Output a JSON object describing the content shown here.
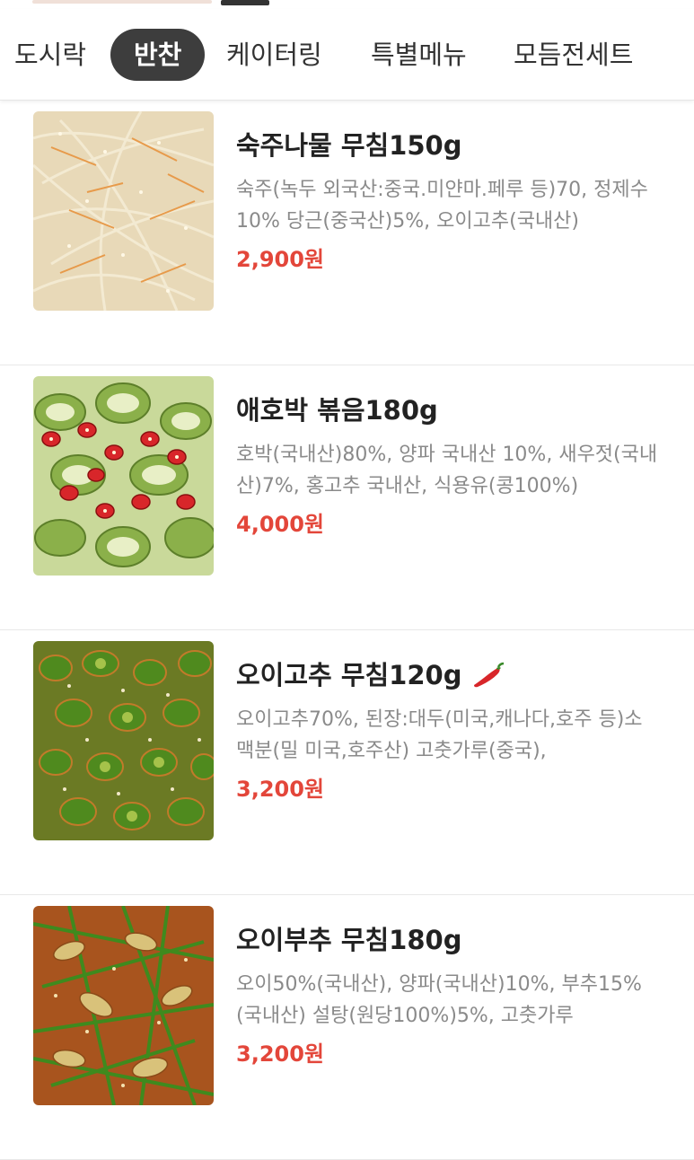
{
  "tabs": [
    {
      "label": "도시락",
      "active": false
    },
    {
      "label": "반찬",
      "active": true
    },
    {
      "label": "케이터링",
      "active": false
    },
    {
      "label": "특별메뉴",
      "active": false
    },
    {
      "label": "모듬전세트",
      "active": false
    }
  ],
  "items": [
    {
      "name": "숙주나물 무침150g",
      "description": "숙주(녹두 외국산:중국.미얀마.페루 등)70, 정제수10% 당근(중국산)5%, 오이고추(국내산)",
      "price": "2,900원",
      "spicy": false,
      "image": "bean-sprout-salad-photo"
    },
    {
      "name": "애호박 볶음180g",
      "description": "호박(국내산)80%, 양파 국내산 10%, 새우젓(국내산)7%, 홍고추 국내산, 식용유(콩100%)",
      "price": "4,000원",
      "spicy": false,
      "image": "zucchini-stir-fry-photo"
    },
    {
      "name": "오이고추 무침120g",
      "description": "오이고추70%, 된장:대두(미국,캐나다,호주 등)소맥분(밀 미국,호주산) 고춧가루(중국),",
      "price": "3,200원",
      "spicy": true,
      "image": "seasoned-pepper-photo"
    },
    {
      "name": "오이부추 무침180g",
      "description": "오이50%(국내산), 양파(국내산)10%, 부추15%(국내산) 설탕(원당100%)5%, 고춧가루",
      "price": "3,200원",
      "spicy": false,
      "image": "cucumber-chive-salad-photo"
    }
  ],
  "colors": {
    "price": "#e3463a",
    "active_tab_bg": "#3d3d3d",
    "spicy_icon": "#d8262a"
  }
}
